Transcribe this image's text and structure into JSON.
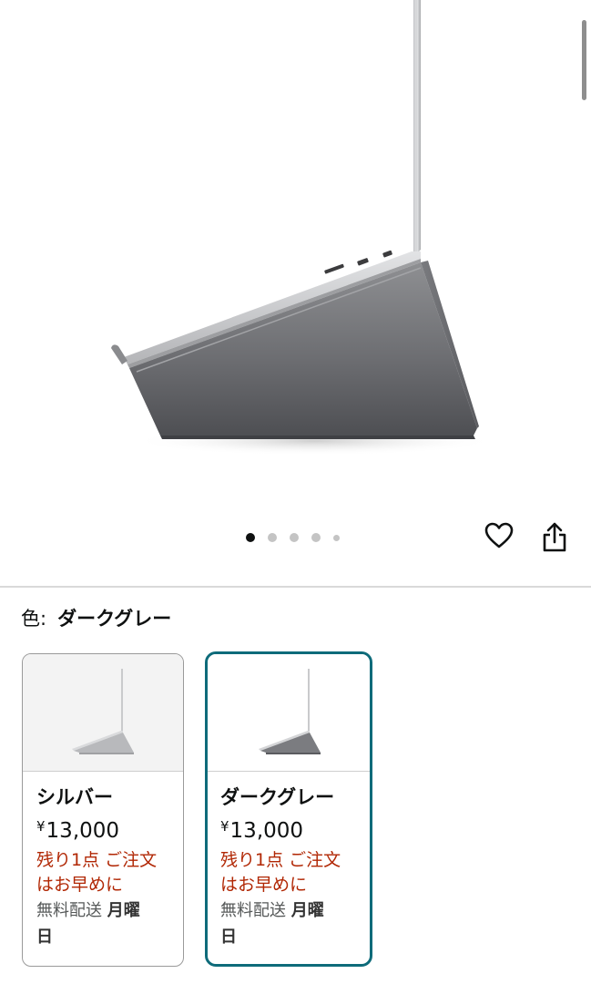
{
  "product": {
    "image_alt": "laptop-stand-dark-gray"
  },
  "carousel": {
    "dot_count": 5,
    "active_index": 0
  },
  "actions": {
    "favorite_icon": "heart-icon",
    "share_icon": "share-icon"
  },
  "color_selector": {
    "label": "色:",
    "selected": "ダークグレー"
  },
  "variants": [
    {
      "name": "シルバー",
      "currency": "¥",
      "price": "13,000",
      "stock_line1": "残り1点 ご注文",
      "stock_line2": "はお早めに",
      "shipping": "無料配送",
      "shipping_day": "月曜",
      "shipping_day2": "日",
      "selected": false
    },
    {
      "name": "ダークグレー",
      "currency": "¥",
      "price": "13,000",
      "stock_line1": "残り1点 ご注文",
      "stock_line2": "はお早めに",
      "shipping": "無料配送",
      "shipping_day": "月曜",
      "shipping_day2": "日",
      "selected": true
    }
  ],
  "colors": {
    "accent_border": "#0e6b7a",
    "stock_red": "#b12704"
  }
}
